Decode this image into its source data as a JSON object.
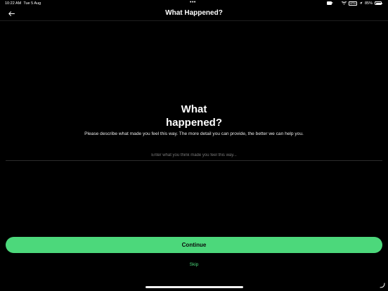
{
  "status_bar": {
    "time": "10:22 AM",
    "date": "Tue 5 Aug",
    "dots": "•••",
    "vpn": "VPN",
    "battery": "85%"
  },
  "nav": {
    "title": "What Happened?",
    "back_icon": "arrow-left-icon"
  },
  "content": {
    "headline_line1": "What",
    "headline_line2": "happened?",
    "description": "Please describe what made you feel this way. The more detail you can provide, the better we can help you."
  },
  "input": {
    "value": "",
    "placeholder": "Enter what you think made you feel this way..."
  },
  "actions": {
    "continue_label": "Continue",
    "skip_label": "Skip"
  },
  "colors": {
    "accent": "#4cd87b",
    "background": "#000000"
  }
}
